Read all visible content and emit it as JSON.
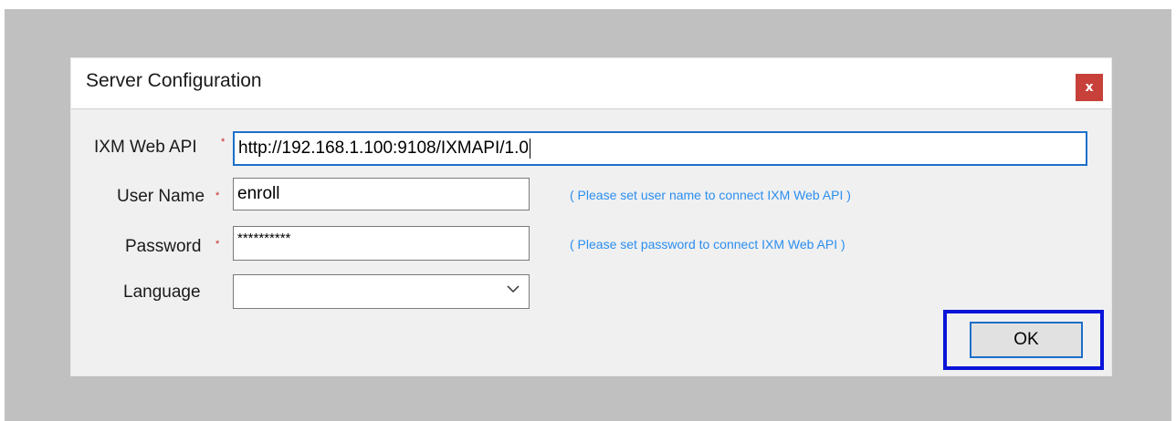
{
  "dialog": {
    "title": "Server Configuration",
    "close_label": "x"
  },
  "form": {
    "api": {
      "label": "IXM Web API",
      "required_mark": "*",
      "value": "http://192.168.1.100:9108/IXMAPI/1.0"
    },
    "username": {
      "label": "User Name",
      "required_mark": "*",
      "value": "enroll",
      "hint": "( Please set user name to connect IXM Web API )"
    },
    "password": {
      "label": "Password",
      "required_mark": "*",
      "value": "**********",
      "hint": "( Please set password to connect IXM Web API )"
    },
    "language": {
      "label": "Language",
      "value": ""
    }
  },
  "buttons": {
    "ok_label": "OK"
  },
  "colors": {
    "backdrop": "#c0c0c0",
    "dialog_bg": "#f0f0f0",
    "close_bg": "#c7413a",
    "hint": "#2a8ef0",
    "focus_border": "#1c6fc9",
    "highlight_border": "#0a14d8",
    "required": "#cc2222"
  },
  "icons": {
    "close": "close-icon",
    "dropdown": "chevron-down-icon"
  }
}
